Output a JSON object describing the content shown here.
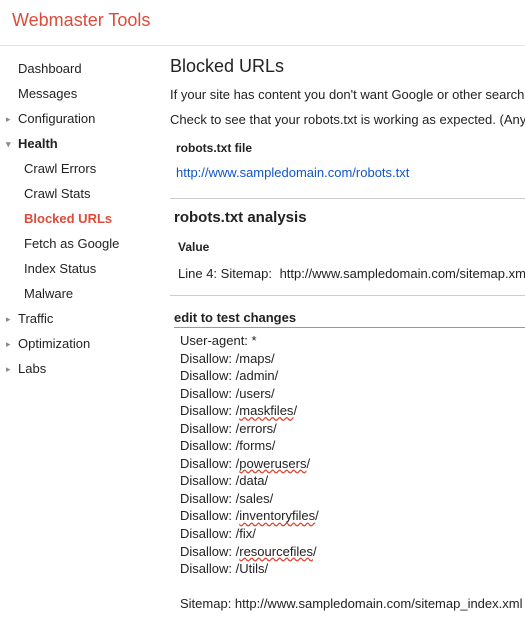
{
  "header": {
    "title": "Webmaster Tools"
  },
  "sidebar": {
    "dashboard": "Dashboard",
    "messages": "Messages",
    "configuration": "Configuration",
    "health": "Health",
    "health_children": {
      "crawl_errors": "Crawl Errors",
      "crawl_stats": "Crawl Stats",
      "blocked_urls": "Blocked URLs",
      "fetch_as_google": "Fetch as Google",
      "index_status": "Index Status",
      "malware": "Malware"
    },
    "traffic": "Traffic",
    "optimization": "Optimization",
    "labs": "Labs"
  },
  "main": {
    "title": "Blocked URLs",
    "intro1": "If your site has content you don't want Google or other search engines to",
    "intro2": "Check to see that your robots.txt is working as expected. (Any changes",
    "robots_file_label": "robots.txt file",
    "robots_url": "http://www.sampledomain.com/robots.txt",
    "analysis_title": "robots.txt analysis",
    "value_label": "Value",
    "line4_prefix": "Line 4: Sitemap:",
    "line4_url": "http://www.sampledomain.com/sitemap.xml",
    "edit_title": "edit to test changes",
    "robots_content": [
      {
        "t": "User-agent: *"
      },
      {
        "t": "Disallow: /maps/"
      },
      {
        "t": "Disallow: /admin/"
      },
      {
        "t": "Disallow: /users/"
      },
      {
        "p": "Disallow: /",
        "s": "maskfiles",
        "a": "/"
      },
      {
        "t": "Disallow: /errors/"
      },
      {
        "t": "Disallow: /forms/"
      },
      {
        "p": "Disallow: /",
        "s": "powerusers",
        "a": "/"
      },
      {
        "t": "Disallow: /data/"
      },
      {
        "t": "Disallow: /sales/"
      },
      {
        "p": "Disallow: /",
        "s": "inventoryfiles",
        "a": "/"
      },
      {
        "t": "Disallow: /fix/"
      },
      {
        "p": "Disallow: /",
        "s": "resourcefiles",
        "a": "/"
      },
      {
        "t": "Disallow: /Utils/"
      },
      {
        "t": ""
      },
      {
        "t": "Sitemap: http://www.sampledomain.com/sitemap_index.xml"
      }
    ]
  }
}
